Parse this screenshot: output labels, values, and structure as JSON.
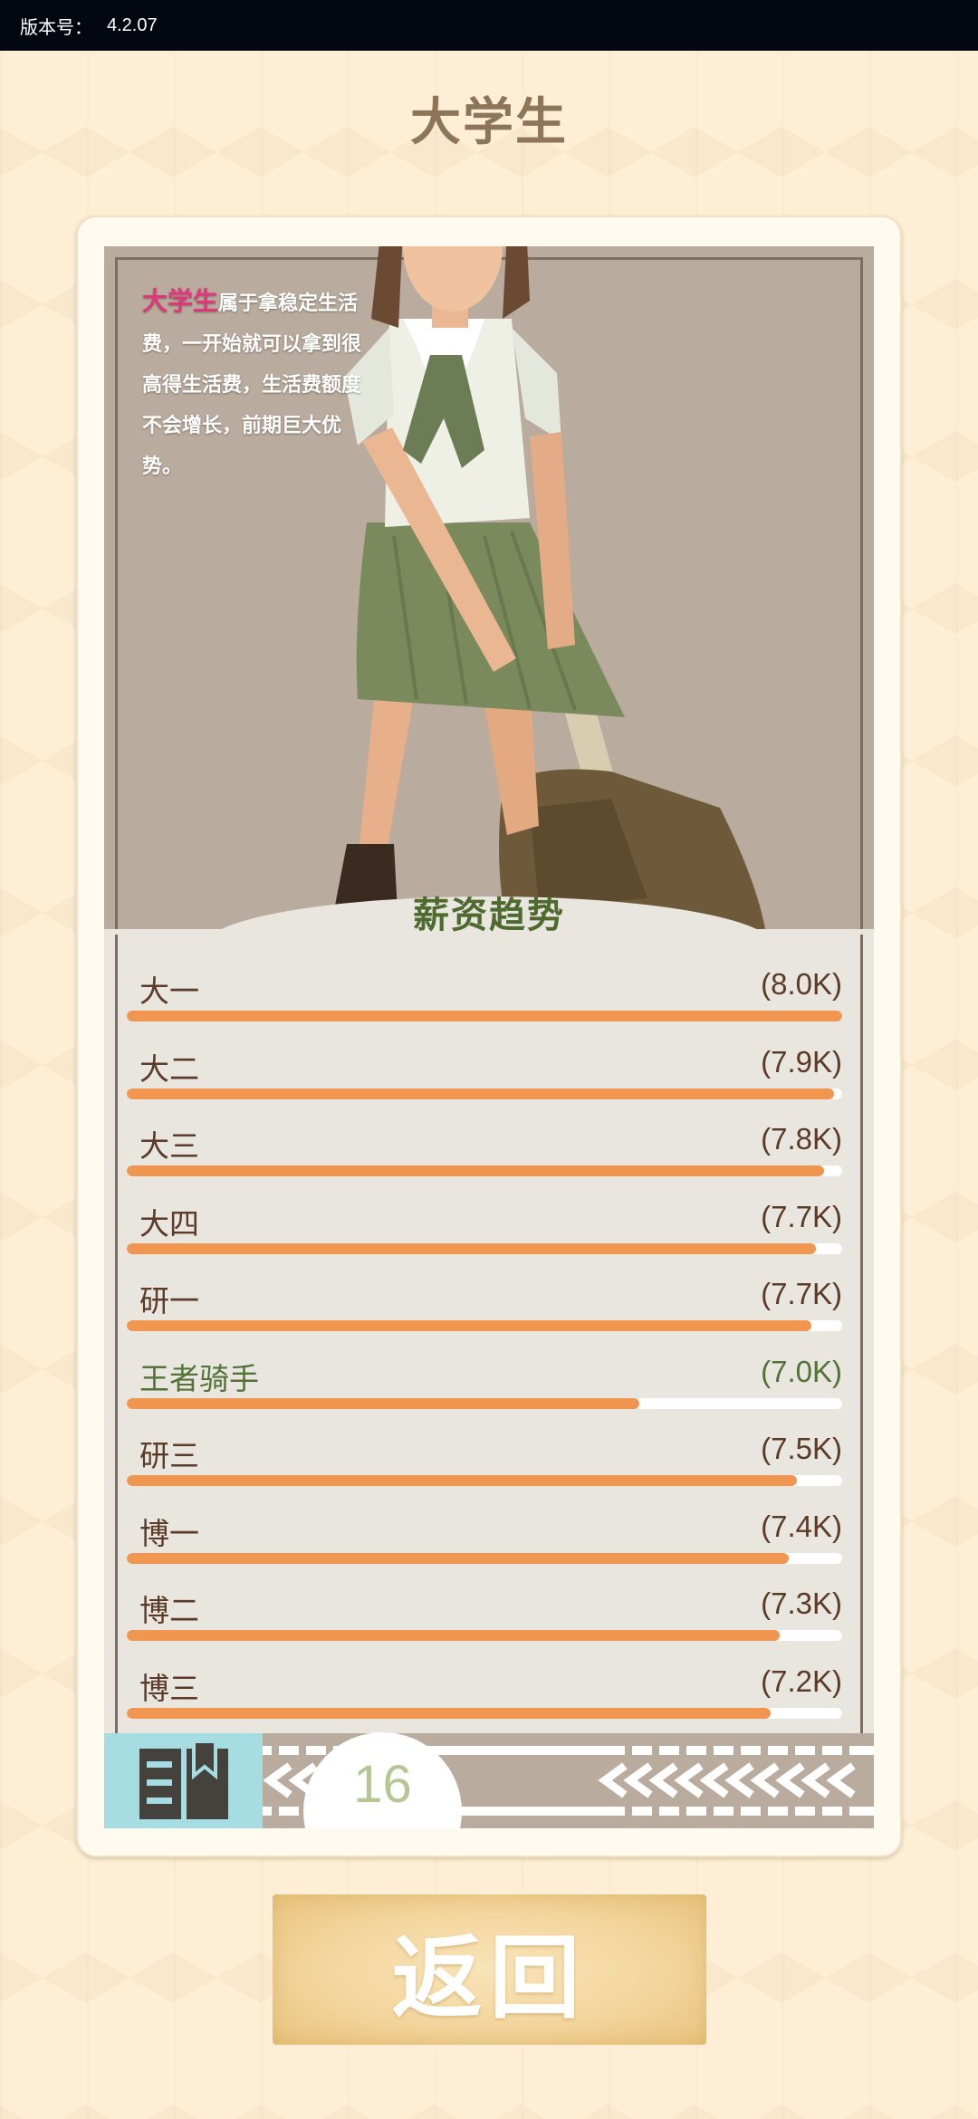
{
  "status_bar": {
    "version_label": "版本号：",
    "version_value": "4.2.07"
  },
  "page_title": "大学生",
  "description": {
    "highlight": "大学生",
    "text": "属于拿稳定生活费，一开始就可以拿到很高得生活费，生活费额度不会增长，前期巨大优势。"
  },
  "section_title": "薪资趋势",
  "salary_rows": [
    {
      "label": "大一",
      "value": "(8.0K)",
      "fill": 1.0,
      "player": false
    },
    {
      "label": "大二",
      "value": "(7.9K)",
      "fill": 0.988,
      "player": false
    },
    {
      "label": "大三",
      "value": "(7.8K)",
      "fill": 0.975,
      "player": false
    },
    {
      "label": "大四",
      "value": "(7.7K)",
      "fill": 0.963,
      "player": false
    },
    {
      "label": "研一",
      "value": "(7.7K)",
      "fill": 0.957,
      "player": false
    },
    {
      "label": "王者骑手",
      "value": "(7.0K)",
      "fill": 0.717,
      "player": true
    },
    {
      "label": "研三",
      "value": "(7.5K)",
      "fill": 0.937,
      "player": false
    },
    {
      "label": "博一",
      "value": "(7.4K)",
      "fill": 0.925,
      "player": false
    },
    {
      "label": "博二",
      "value": "(7.3K)",
      "fill": 0.913,
      "player": false
    },
    {
      "label": "博三",
      "value": "(7.2K)",
      "fill": 0.9,
      "player": false
    }
  ],
  "page_number": "16",
  "back_button": "返回",
  "colors": {
    "accent_orange": "#f09650",
    "highlight_pink": "#e0367a",
    "player_green": "#527237",
    "title_brown": "#8c7558"
  },
  "icons": {
    "book": "book-icon"
  }
}
